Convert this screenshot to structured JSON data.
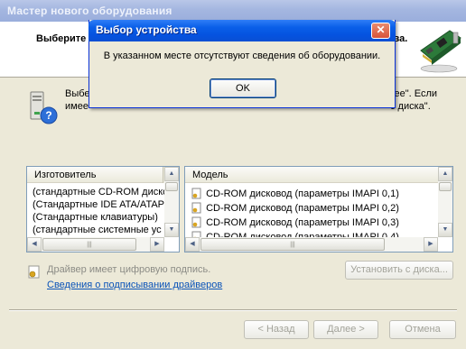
{
  "wizard": {
    "title": "Мастер нового оборудования",
    "header_title_left": "Выберите",
    "header_title_right": "ства.",
    "desc_line1_left": "Выбе",
    "desc_line2_left": "имее",
    "desc_line1_right": "алее\". Если",
    "desc_line2_right": "с диска\".",
    "manufacturer_header": "Изготовитель",
    "manufacturers": [
      "(стандартные CD-ROM диско",
      "(Стандартные IDE ATA/ATAP",
      "(Стандартные клавиатуры)",
      "(стандартные системные ус"
    ],
    "model_header": "Модель",
    "models": [
      "CD-ROM дисковод (параметры IMAPI 0,1)",
      "CD-ROM дисковод (параметры IMAPI 0,2)",
      "CD-ROM дисковод (параметры IMAPI 0,3)",
      "CD-ROM дисковод (параметры IMAPI 0,4)"
    ],
    "signed_driver_text": "Драйвер имеет цифровую подпись.",
    "signing_link": "Сведения о подписывании драйверов",
    "have_disk_button": "Установить с диска...",
    "back_button": "< Назад",
    "next_button": "Далее >",
    "cancel_button": "Отмена"
  },
  "dialog": {
    "title": "Выбор устройства",
    "message": "В указанном месте отсутствуют сведения об оборудовании.",
    "ok_button": "OK",
    "close_glyph": "✕"
  },
  "icons": {
    "hardware": "network-card-icon",
    "device_question": "device-help-icon",
    "driver": "driver-icon",
    "signature": "certificate-icon"
  },
  "colors": {
    "dialog_title": "#0553e0",
    "link": "#0a53b8"
  }
}
